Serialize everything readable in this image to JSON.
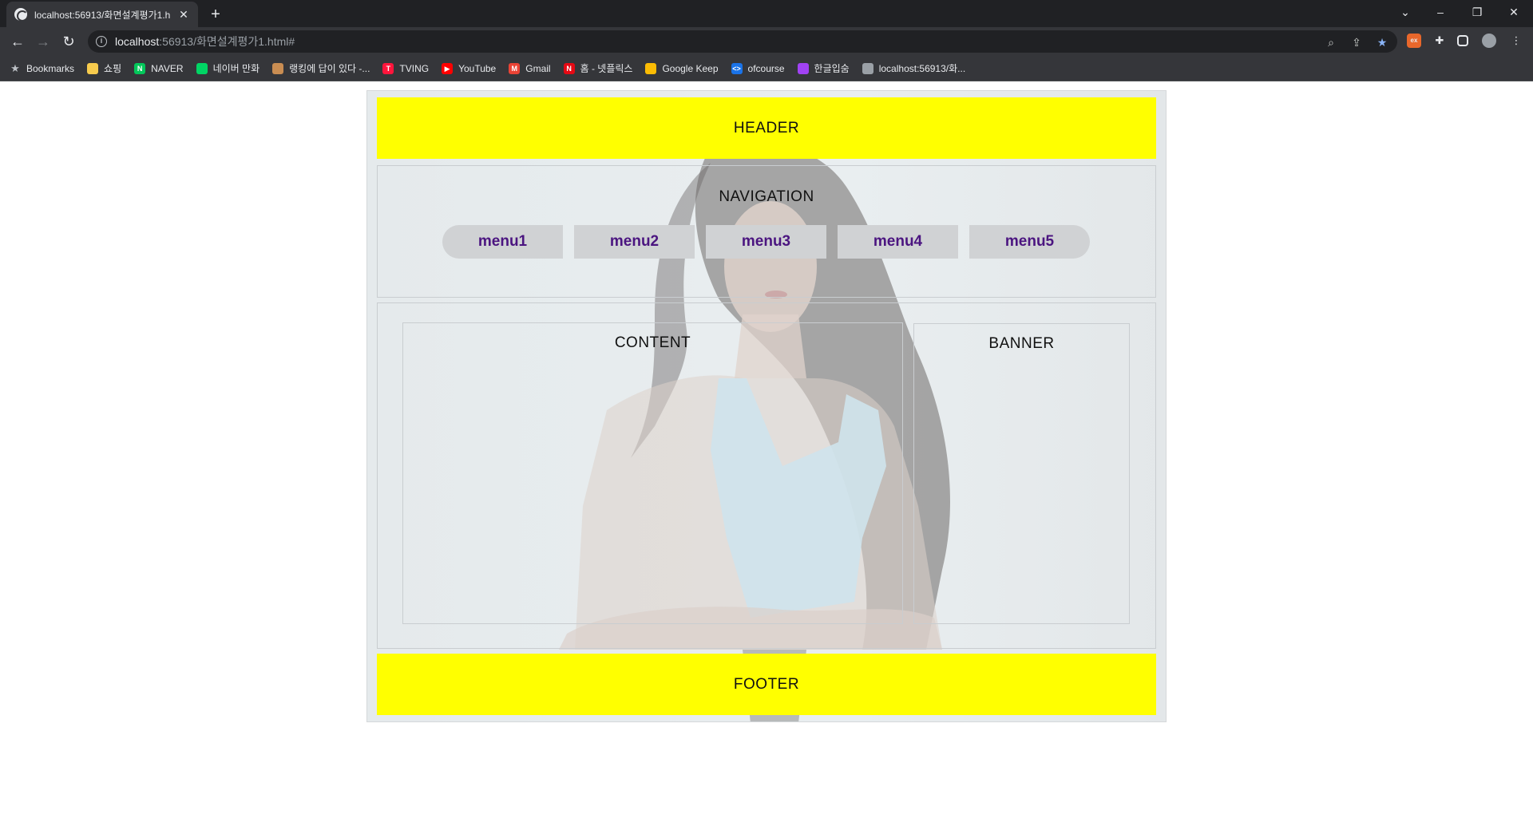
{
  "browser": {
    "tab_title": "localhost:56913/화면설계평가1.h",
    "tab_close": "✕",
    "new_tab": "+",
    "url_host": "localhost",
    "url_rest": ":56913/화면설계평가1.html#",
    "window_controls": {
      "chevron": "⌄",
      "minimize": "–",
      "restore": "❐",
      "close": "✕"
    }
  },
  "bookmarks": [
    {
      "label": "Bookmarks",
      "icon": "star-icon",
      "color": "#bdc1c6",
      "glyph": "★"
    },
    {
      "label": "쇼핑",
      "icon": "folder-icon",
      "color": "#f7cb4d",
      "glyph": ""
    },
    {
      "label": "NAVER",
      "icon": "naver-icon",
      "color": "#03c75a",
      "glyph": "N"
    },
    {
      "label": "네이버 만화",
      "icon": "naver-webtoon-icon",
      "color": "#00d564",
      "glyph": ""
    },
    {
      "label": "랭킹에 답이 있다 -...",
      "icon": "ranking-icon",
      "color": "#c98d52",
      "glyph": ""
    },
    {
      "label": "TVING",
      "icon": "tving-icon",
      "color": "#ff153c",
      "glyph": "T"
    },
    {
      "label": "YouTube",
      "icon": "youtube-icon",
      "color": "#ff0000",
      "glyph": "▶"
    },
    {
      "label": "Gmail",
      "icon": "gmail-icon",
      "color": "#ea4335",
      "glyph": "M"
    },
    {
      "label": "홈 - 넷플릭스",
      "icon": "netflix-icon",
      "color": "#e50914",
      "glyph": "N"
    },
    {
      "label": "Google Keep",
      "icon": "google-keep-icon",
      "color": "#fbbc04",
      "glyph": ""
    },
    {
      "label": "ofcourse",
      "icon": "ofcourse-icon",
      "color": "#1a73e8",
      "glyph": "<>"
    },
    {
      "label": "한글입숨",
      "icon": "hangul-icon",
      "color": "#a142f4",
      "glyph": ""
    },
    {
      "label": "localhost:56913/화...",
      "icon": "globe-icon",
      "color": "#9aa0a6",
      "glyph": ""
    }
  ],
  "page": {
    "header": "HEADER",
    "navigation": "NAVIGATION",
    "menus": [
      "menu1",
      "menu2",
      "menu3",
      "menu4",
      "menu5"
    ],
    "content": "CONTENT",
    "banner": "BANNER",
    "footer": "FOOTER"
  },
  "colors": {
    "header_bg": "#ffff00",
    "footer_bg": "#ffff00",
    "menu_bg": "#d0d2d4",
    "menu_text": "#4b1580"
  }
}
